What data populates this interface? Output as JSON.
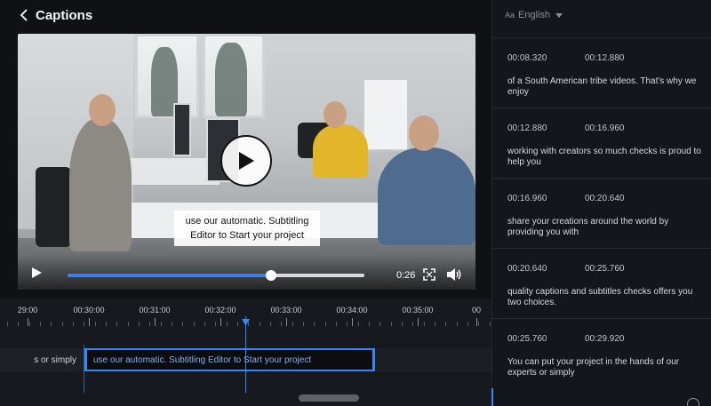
{
  "header": {
    "title": "Captions"
  },
  "video": {
    "subtitle": "use our automatic. Subtitling Editor to Start your project",
    "current_time": "0:26",
    "progress_fraction": 0.685
  },
  "timeline": {
    "labels": [
      "29:00",
      "00:30:00",
      "00:31:00",
      "00:32:00",
      "00:33:00",
      "00:34:00",
      "00:35:00",
      "00"
    ],
    "prev_clip": "s or simply",
    "active_clip": "use our automatic. Subtitling Editor to Start your project"
  },
  "language": {
    "icon": "Aa",
    "label": "English"
  },
  "cues": [
    {
      "start": "00:08.320",
      "end": "00:12.880",
      "text": "of a South American tribe videos. That's why we enjoy"
    },
    {
      "start": "00:12.880",
      "end": "00:16.960",
      "text": "working with creators so much checks is proud to help you"
    },
    {
      "start": "00:16.960",
      "end": "00:20.640",
      "text": "share your creations around the world by providing you with"
    },
    {
      "start": "00:20.640",
      "end": "00:25.760",
      "text": "quality captions and subtitles checks offers you two choices."
    },
    {
      "start": "00:25.760",
      "end": "00:29.920",
      "text": "You can put your project in the hands of our experts or simply"
    }
  ],
  "colors": {
    "accent": "#3b87f0",
    "background": "#0d0f12"
  }
}
